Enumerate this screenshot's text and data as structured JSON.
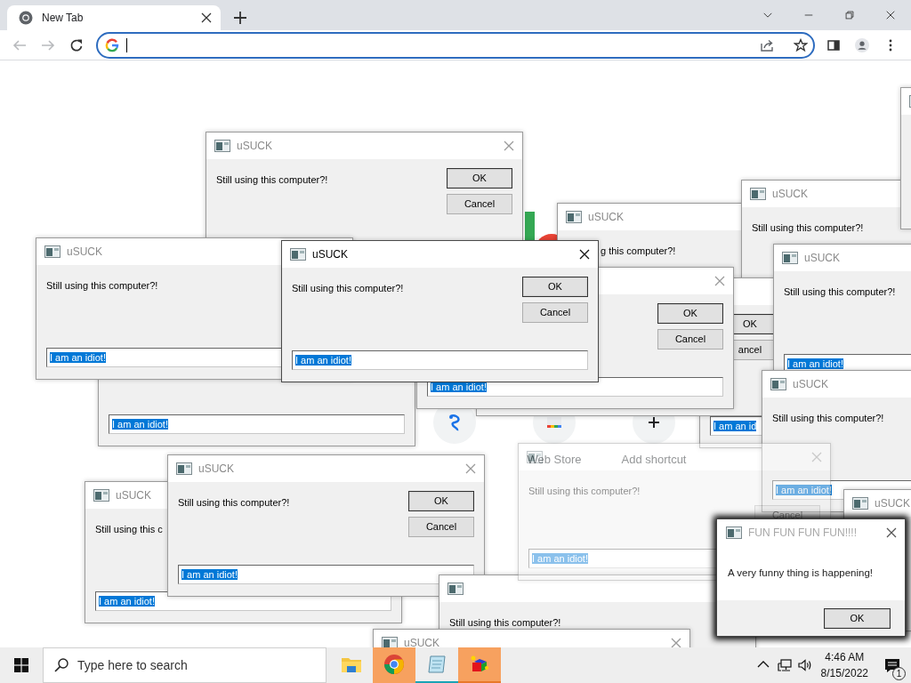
{
  "browser": {
    "tab": {
      "title": "New Tab",
      "selected": true
    },
    "back_disabled": true,
    "forward_disabled": true
  },
  "page": {
    "shortcuts": [
      {
        "kind": "swirl"
      },
      {
        "kind": "store",
        "label": "Web Store"
      },
      {
        "kind": "add",
        "label": "Add shortcut"
      }
    ]
  },
  "dialogs": [
    {
      "kind": "dialog",
      "title": "uSUCK",
      "message": "Still using this computer?!",
      "ok": "OK",
      "cancel": "Cancel",
      "active": false,
      "faded": false
    },
    {
      "kind": "dialog",
      "input_value": "I am an idiot!",
      "text_selected": true,
      "faded": false
    },
    {
      "kind": "dialog",
      "title": "uSUCK",
      "message": "g this computer?!",
      "active": false,
      "faded": false
    },
    {
      "kind": "dialog",
      "title": "uSUCK",
      "message": "Still using this computer?!",
      "active": false,
      "faded": false
    },
    {
      "kind": "dialog",
      "faded": false
    },
    {
      "kind": "dialog",
      "input_value": "I am an id",
      "text_selected": true,
      "faded": false
    },
    {
      "kind": "dialog",
      "ok": "OK",
      "cancel": "ancel",
      "faded": false
    },
    {
      "kind": "dialog",
      "ok": "OK",
      "cancel": "Cancel",
      "input_value": "I am an idiot!",
      "text_selected": true,
      "active": false,
      "faded": false
    },
    {
      "kind": "dialog",
      "title": "uSUCK",
      "message": "Still using this computer?!",
      "input_value": "I am an idiot!",
      "text_selected": true,
      "active": false,
      "faded": false
    },
    {
      "kind": "dialog",
      "title": "uSUCK",
      "message": "Still using this computer?!",
      "input_value": "I am an idiot!",
      "text_selected": true,
      "active": false,
      "faded": false
    },
    {
      "kind": "dialog",
      "title": "uSUCK",
      "message": "Still using this computer?!",
      "input_value": "I am an idiot!",
      "text_selected": true,
      "active": false,
      "faded": false
    },
    {
      "kind": "dialog",
      "title": "uSUCK",
      "message": "Still using this computer?!",
      "ok": "OK",
      "cancel": "Cancel",
      "input_value": "I am an idiot!",
      "text_selected": true,
      "active": true,
      "faded": false
    },
    {
      "kind": "dialog",
      "title": "uSUCK",
      "message": "Still using this c",
      "input_value": "I am an idiot!",
      "text_selected": true,
      "active": false,
      "faded": false
    },
    {
      "kind": "dialog",
      "title": "uSUCK",
      "message": "Still using this computer?!",
      "ok": "OK",
      "cancel": "Cancel",
      "input_value": "I am an idiot!",
      "text_selected": true,
      "active": false,
      "faded": false
    },
    {
      "kind": "dialog",
      "message": "Still using this computer?!",
      "faded": false
    },
    {
      "kind": "dialog",
      "title": "uSUCK",
      "active": false
    },
    {
      "kind": "dialog",
      "message": "Still using this computer?!",
      "cancel": "Cancel",
      "input_value": "I am an idiot!",
      "text_selected": true,
      "active": false,
      "faded": true
    },
    {
      "kind": "dialog",
      "title": "uSUCK",
      "active": false
    },
    {
      "kind": "message_box",
      "title": "FUN FUN FUN FUN!!!!",
      "message": "A very funny thing is happening!",
      "ok": "OK",
      "active": false,
      "faded": false
    }
  ],
  "taskbar": {
    "search_placeholder": "Type here to search",
    "apps": [
      {
        "kind": "folder",
        "flashing": false,
        "open": false
      },
      {
        "kind": "browser",
        "flashing": true,
        "open": false
      },
      {
        "kind": "notepad",
        "flashing": false,
        "open": true
      },
      {
        "kind": "cube",
        "flashing": true,
        "open": true
      }
    ],
    "time": "4:46 AM",
    "date": "8/15/2022",
    "notifications": "1"
  }
}
